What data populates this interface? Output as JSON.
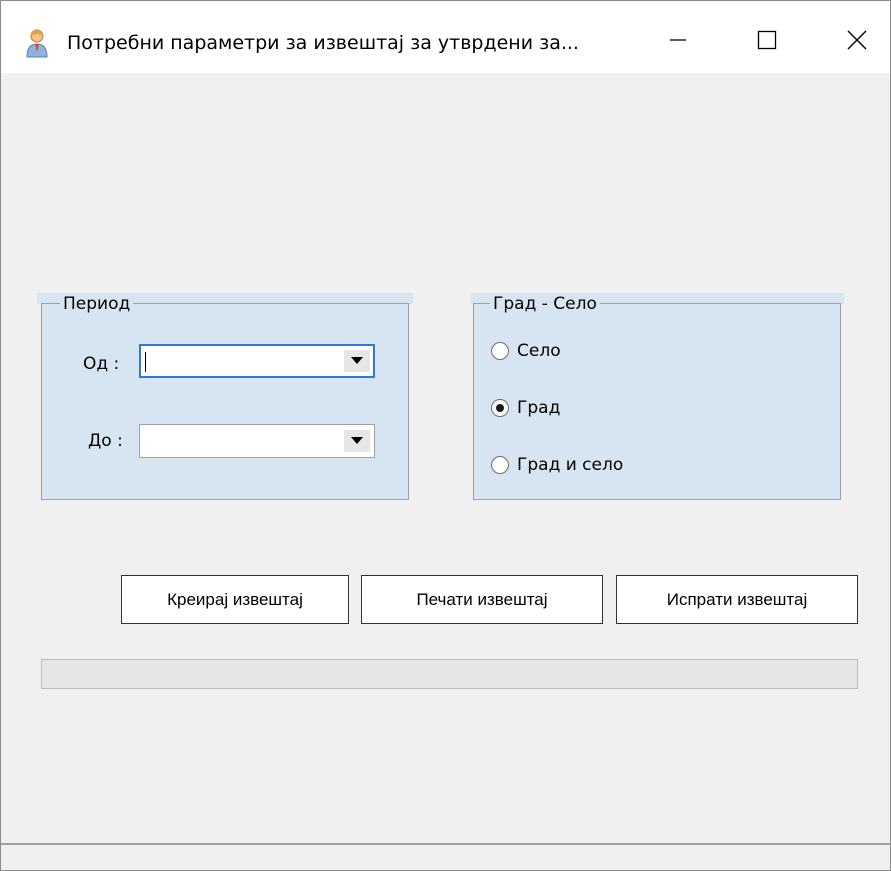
{
  "window": {
    "title": "Потребни  параметри за извештај за утврдени за..."
  },
  "period_group": {
    "legend": "Период",
    "from_label": "Од :",
    "from_value": "",
    "to_label": "До :",
    "to_value": ""
  },
  "location_group": {
    "legend": "Град - Село",
    "options": [
      {
        "label": "Село",
        "checked": false
      },
      {
        "label": "Град",
        "checked": true
      },
      {
        "label": "Град и село",
        "checked": false
      }
    ]
  },
  "buttons": {
    "create": "Креирај извештај",
    "print": "Печати извештај",
    "send": "Испрати извештај"
  },
  "progress": {
    "percent": 0
  },
  "colors": {
    "group_background": "#d7e4f2",
    "window_background": "#f0f0f0",
    "focus_border": "#2e7bd6"
  },
  "icons": {
    "app": "user-icon",
    "minimize": "minimize-icon",
    "maximize": "maximize-icon",
    "close": "close-icon",
    "dropdown": "chevron-down-icon"
  }
}
